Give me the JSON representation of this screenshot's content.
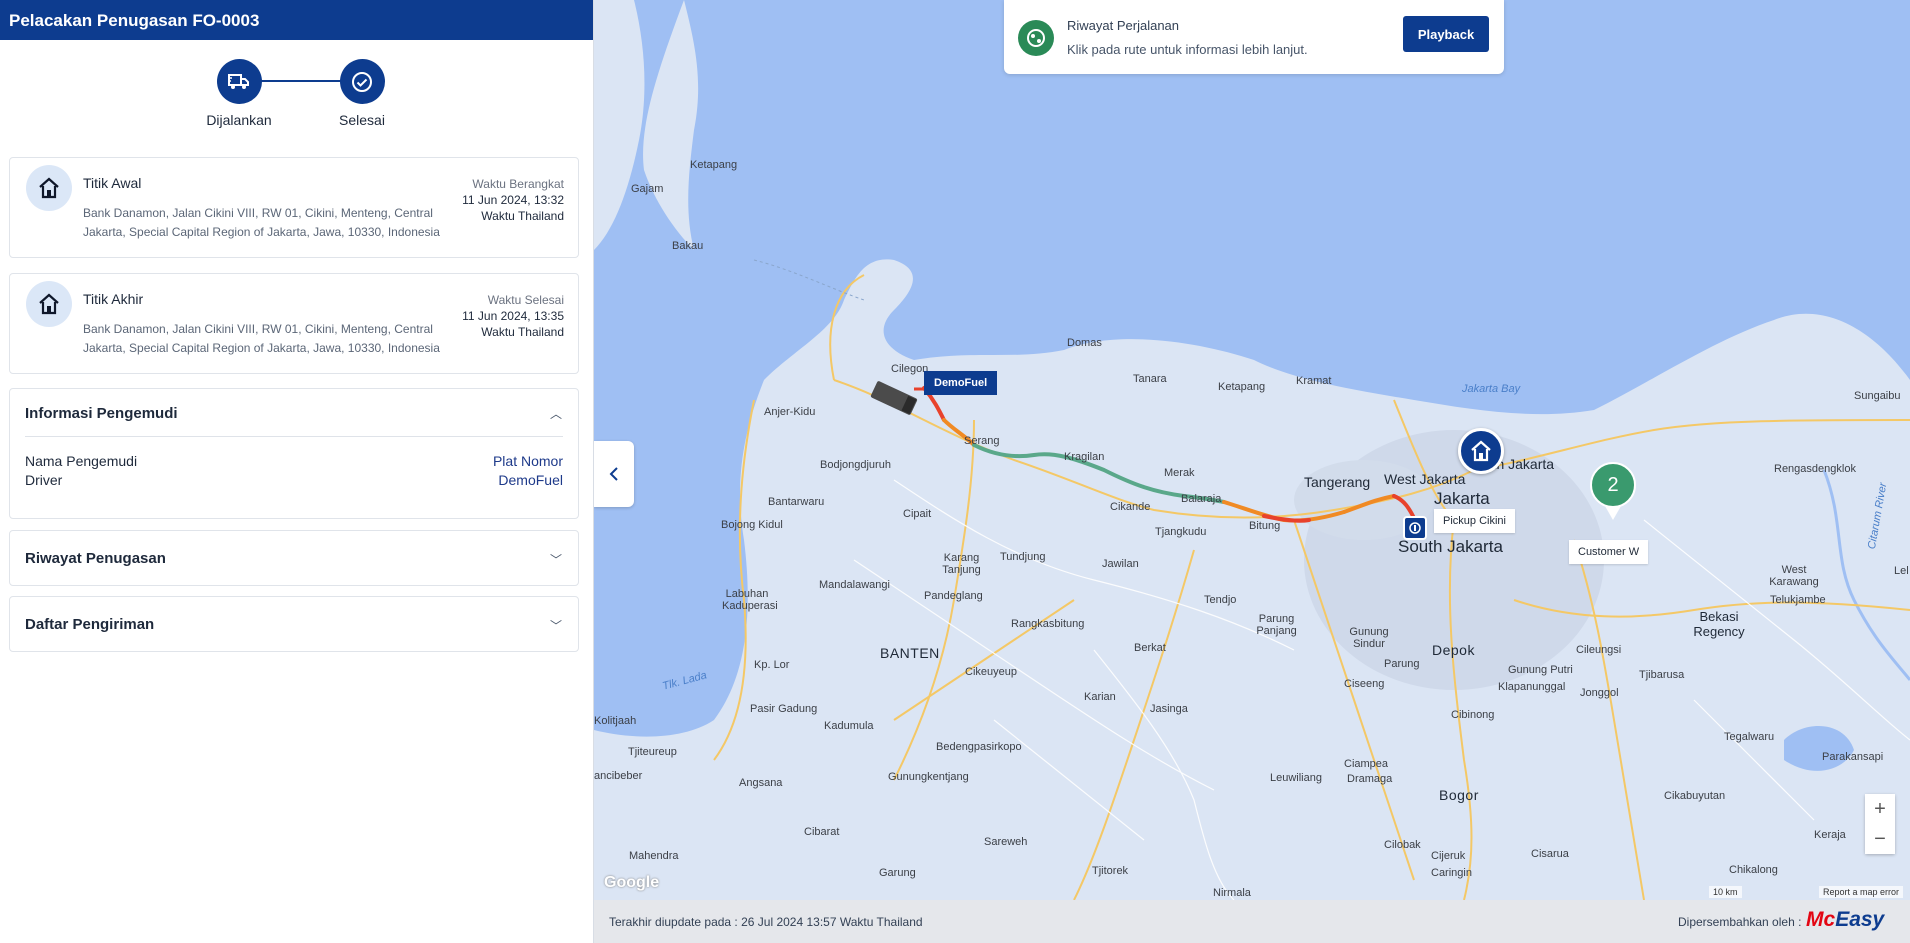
{
  "header": {
    "title": "Pelacakan Penugasan FO-0003"
  },
  "stepper": {
    "steps": [
      {
        "label": "Dijalankan"
      },
      {
        "label": "Selesai"
      }
    ]
  },
  "start_point": {
    "title": "Titik Awal",
    "address": "Bank Danamon, Jalan Cikini VIII, RW 01, Cikini, Menteng, Central Jakarta, Special Capital Region of Jakarta, Jawa, 10330, Indonesia",
    "time_label": "Waktu Berangkat",
    "time_value": "11 Jun 2024, 13:32",
    "timezone": "Waktu Thailand"
  },
  "end_point": {
    "title": "Titik Akhir",
    "address": "Bank Danamon, Jalan Cikini VIII, RW 01, Cikini, Menteng, Central Jakarta, Special Capital Region of Jakarta, Jawa, 10330, Indonesia",
    "time_label": "Waktu Selesai",
    "time_value": "11 Jun 2024, 13:35",
    "timezone": "Waktu Thailand"
  },
  "driver_info": {
    "title": "Informasi Pengemudi",
    "driver_name_label": "Nama Pengemudi",
    "driver_name_value": "Driver",
    "plate_label": "Plat Nomor",
    "plate_value": "DemoFuel"
  },
  "assignment_history": {
    "title": "Riwayat Penugasan"
  },
  "delivery_list": {
    "title": "Daftar Pengiriman"
  },
  "map": {
    "trip_history": {
      "title": "Riwayat Perjalanan",
      "subtitle": "Klik pada rute untuk informasi lebih lanjut.",
      "button": "Playback"
    },
    "vehicle_label": "DemoFuel",
    "pickup_label": "Pickup Cikini",
    "customer_label": "Customer W",
    "cluster_count": "2",
    "zoom_in": "+",
    "zoom_out": "−",
    "google": "Google",
    "scale": "10 km",
    "report": "Report a map error",
    "places": [
      {
        "name": "Ketapang"
      },
      {
        "name": "Gajam"
      },
      {
        "name": "Bakau"
      },
      {
        "name": "Cilegon"
      },
      {
        "name": "Domas"
      },
      {
        "name": "Anjer-Kidu"
      },
      {
        "name": "Tanara"
      },
      {
        "name": "Ketapang"
      },
      {
        "name": "Kramat"
      },
      {
        "name": "Jakarta Bay"
      },
      {
        "name": "Sungaibu"
      },
      {
        "name": "Serang"
      },
      {
        "name": "Kragilan"
      },
      {
        "name": "Bodjongdjuruh"
      },
      {
        "name": "Merak"
      },
      {
        "name": "Tangerang"
      },
      {
        "name": "West Jakarta"
      },
      {
        "name": "North Jakarta"
      },
      {
        "name": "Jakarta"
      },
      {
        "name": "Rengasdengklok"
      },
      {
        "name": "Bantarwaru"
      },
      {
        "name": "Cikande"
      },
      {
        "name": "Balaraja"
      },
      {
        "name": "Cipait"
      },
      {
        "name": "Bojong Kidul"
      },
      {
        "name": "Tjangkudu"
      },
      {
        "name": "Bitung"
      },
      {
        "name": "South Jakarta"
      },
      {
        "name": "Karang Tanjung"
      },
      {
        "name": "Tundjung"
      },
      {
        "name": "Jawilan"
      },
      {
        "name": "Mandalawangi"
      },
      {
        "name": "Pandeglang"
      },
      {
        "name": "Tendjo"
      },
      {
        "name": "Parung Panjang"
      },
      {
        "name": "Gunung Sindur"
      },
      {
        "name": "Parung"
      },
      {
        "name": "Depok"
      },
      {
        "name": "Gunung Putri"
      },
      {
        "name": "Cileungsi"
      },
      {
        "name": "Klapanunggal"
      },
      {
        "name": "Jonggol"
      },
      {
        "name": "Tjibarusa"
      },
      {
        "name": "Bekasi Regency"
      },
      {
        "name": "West Karawang"
      },
      {
        "name": "Telukjambe"
      },
      {
        "name": "Labuhan Kaduperasi"
      },
      {
        "name": "BANTEN"
      },
      {
        "name": "Rangkasbitung"
      },
      {
        "name": "Berkat"
      },
      {
        "name": "Kp. Lor"
      },
      {
        "name": "Cikeuyeup"
      },
      {
        "name": "Ciseeng"
      },
      {
        "name": "Cibinong"
      },
      {
        "name": "Tlk. Lada"
      },
      {
        "name": "Karian"
      },
      {
        "name": "Jasinga"
      },
      {
        "name": "Pasir Gadung"
      },
      {
        "name": "Kadumula"
      },
      {
        "name": "Kolitjaah"
      },
      {
        "name": "Bedengpasirkopo"
      },
      {
        "name": "Tegalwaru"
      },
      {
        "name": "Tjiteureup"
      },
      {
        "name": "Ciampea"
      },
      {
        "name": "Parakansapi"
      },
      {
        "name": "Angsana"
      },
      {
        "name": "Gunungkentjang"
      },
      {
        "name": "Leuwiliang"
      },
      {
        "name": "Dramaga"
      },
      {
        "name": "Bogor"
      },
      {
        "name": "Cikabuyutan"
      },
      {
        "name": "Cibarat"
      },
      {
        "name": "Sareweh"
      },
      {
        "name": "Cilobak"
      },
      {
        "name": "Keraja"
      },
      {
        "name": "Mahendra"
      },
      {
        "name": "Tjitorek"
      },
      {
        "name": "Cijeruk"
      },
      {
        "name": "Cisarua"
      },
      {
        "name": "Chikalong"
      },
      {
        "name": "Garung"
      },
      {
        "name": "Nirmala"
      },
      {
        "name": "Caringin"
      },
      {
        "name": "ancibeber"
      },
      {
        "name": "Citarum River"
      },
      {
        "name": "Lel"
      }
    ]
  },
  "footer": {
    "updated": "Terakhir diupdate pada : 26 Jul 2024 13:57 Waktu Thailand",
    "powered_by": "Dipersembahkan oleh :",
    "brand_mc": "Mc",
    "brand_easy": "Easy"
  },
  "colors": {
    "primary": "#0d3c8f",
    "success": "#3a9a6e",
    "route_green": "#5aa88a",
    "route_orange": "#f08a24",
    "route_red": "#e8422c",
    "brand_red": "#e30613"
  }
}
